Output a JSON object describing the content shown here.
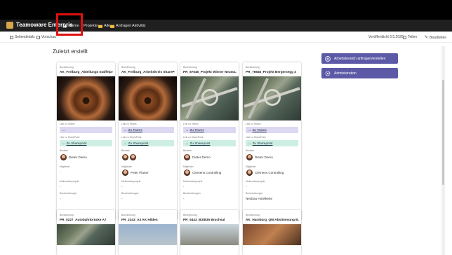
{
  "topbar": {
    "brand": "Teamoware Enterpris",
    "nav": [
      {
        "label": "Home",
        "icon": "home-icon"
      },
      {
        "label": "Projekte",
        "icon": ""
      },
      {
        "label": "Alle",
        "icon": "folder-icon"
      },
      {
        "label": "Anfragen",
        "icon": "folder-icon"
      },
      {
        "label": "Aktivität",
        "icon": ""
      }
    ]
  },
  "cmdbar": {
    "page_details": "Seitendetails",
    "preview": "Vorschau",
    "published": "Veröffentlicht 6.5.2025",
    "share": "Teilen",
    "edit": "Bearbeiten"
  },
  "section_title": "Zuletzt erstellt",
  "labels": {
    "bezeichnung": "Bezeichnung",
    "link_teams": "Link zu Teams",
    "link_sharepoint": "Link zu SharePoint",
    "besitzer": "Besitzer",
    "mitglieder": "Mitglieder",
    "meilensteine": "Meilensteinprojekt",
    "beschreibungen": "Beschreibungen",
    "zu_teams": "Zu Teams",
    "zu_sharepoint": "Zu Sharepoint"
  },
  "cards": [
    {
      "title": "AK_Freiburg_Abteilungs Staffelpro...",
      "image": "hands",
      "owners": [
        "Dieter Demo"
      ],
      "member": "-",
      "milestone": "-",
      "description": "-"
    },
    {
      "title": "AK_Freiburg_Arbeitskreis SharePo...",
      "image": "hands",
      "owners": [
        "",
        ""
      ],
      "member": "Peter Planer",
      "milestone": "-",
      "description": "-"
    },
    {
      "title": "PR_87545_Projekt Wiener Neusta...",
      "image": "road",
      "owners": [
        "Dieter Demo"
      ],
      "member": "Clemens Controlling",
      "milestone": "-",
      "description": "-"
    },
    {
      "title": "PR_76645_Projekt Bergersegg 3",
      "image": "road",
      "owners": [
        "Dieter Demo"
      ],
      "member": "Clemens Controlling",
      "milestone": "-",
      "description": "Neubau Hotelkette"
    }
  ],
  "cards_row2": [
    {
      "title": "PR_0227_Autobahnbrücke A7"
    },
    {
      "title": "PR_2343_A3 AK Hilden"
    },
    {
      "title": "PR_5443_B3/B35 Bruchsal"
    },
    {
      "title": "AK_Hamburg_QM Abstimmung B..."
    }
  ],
  "actions": [
    {
      "label": "Arbeitsbereich anfragen/erstellen",
      "icon": "plus-icon"
    },
    {
      "label": "Administration",
      "icon": "gear-icon"
    }
  ],
  "colors": {
    "accent": "#5c5aa6",
    "teams_pill": "#dcd8f2",
    "sharepoint_pill": "#cdeee3",
    "highlight": "#e01010"
  }
}
